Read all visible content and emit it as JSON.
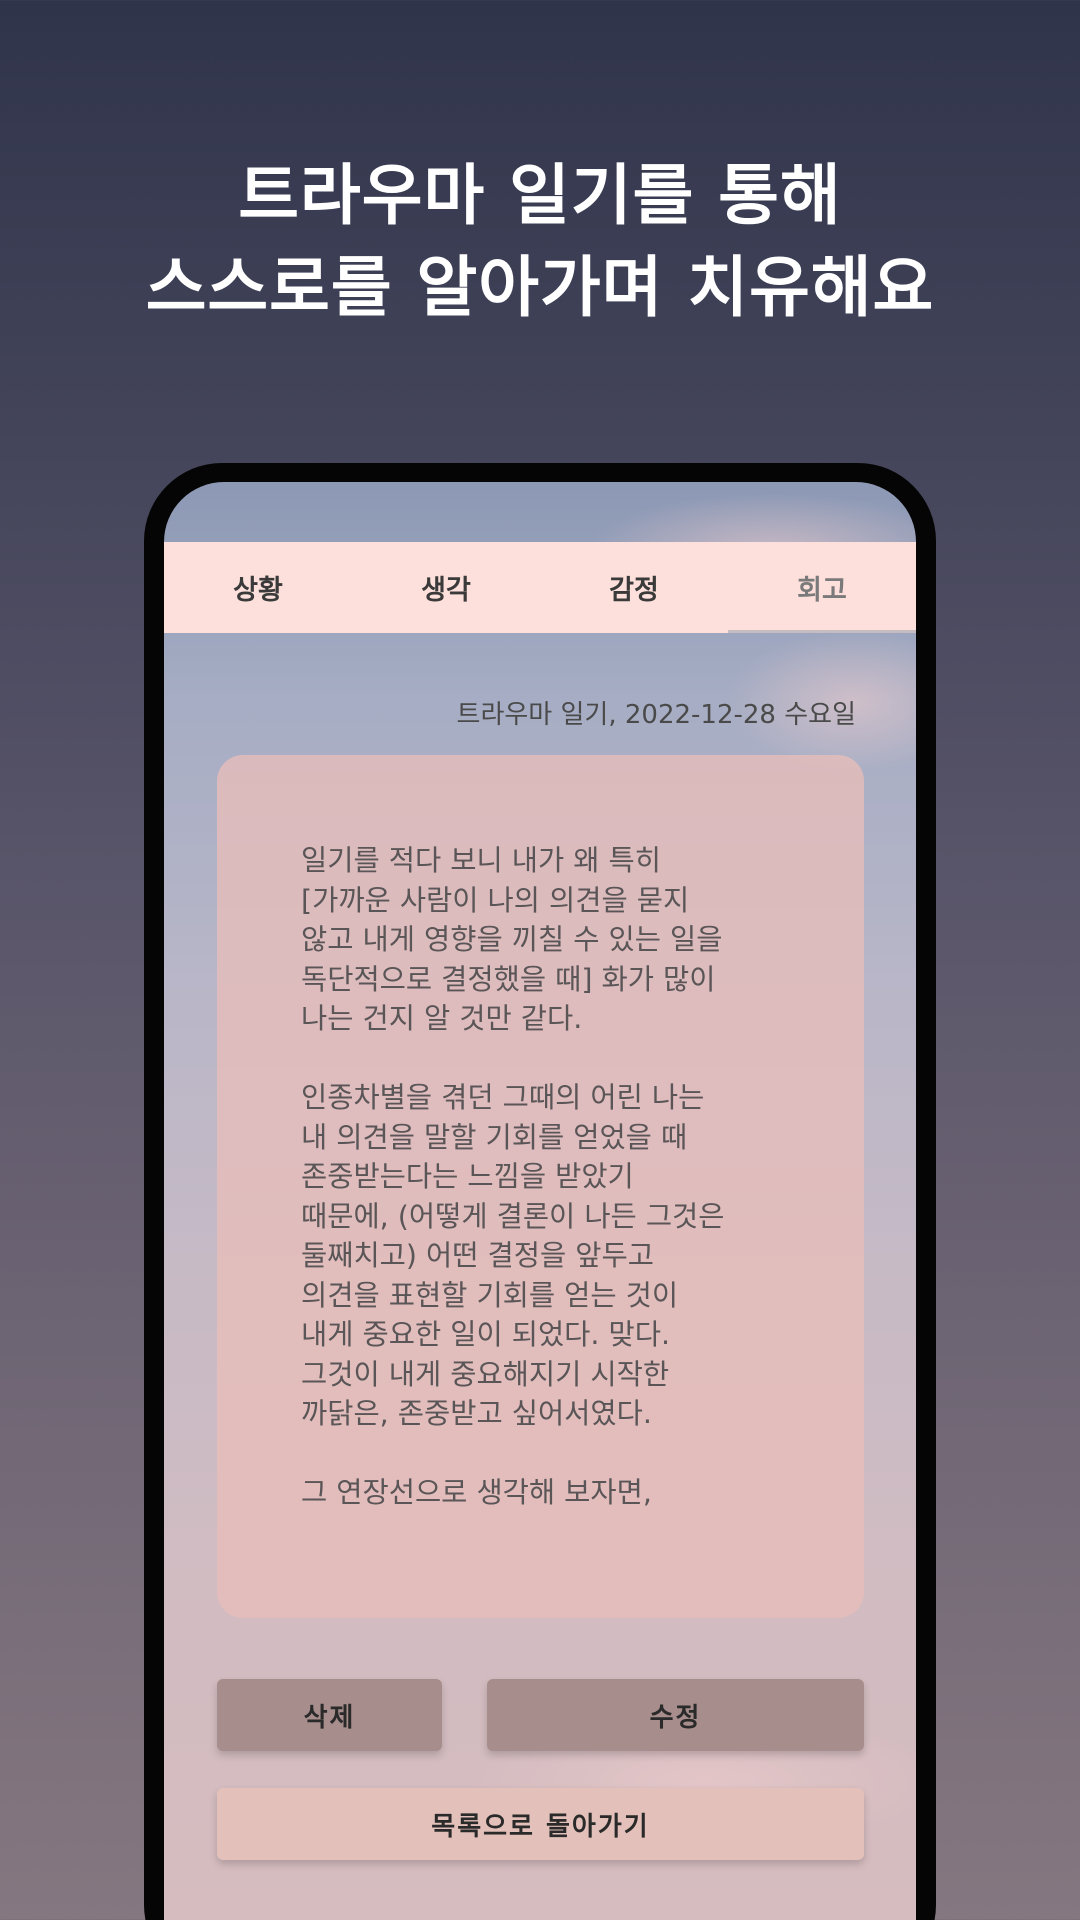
{
  "headline": {
    "line1": "트라우마 일기를 통해",
    "line2": "스스로를 알아가며 치유해요"
  },
  "tabs": [
    {
      "label": "상황",
      "active": false
    },
    {
      "label": "생각",
      "active": false
    },
    {
      "label": "감정",
      "active": false
    },
    {
      "label": "회고",
      "active": true
    }
  ],
  "entry": {
    "date_line": "트라우마 일기,  2022-12-28 수요일",
    "body": "일기를 적다 보니 내가 왜 특히\n[가까운 사람이 나의 의견을 묻지\n않고 내게 영향을 끼칠 수 있는 일을\n독단적으로 결정했을 때] 화가 많이\n나는 건지 알 것만 같다.\n\n인종차별을 겪던 그때의 어린 나는\n내 의견을 말할 기회를 얻었을 때\n존중받는다는 느낌을 받았기\n때문에, (어떻게 결론이 나든 그것은\n둘째치고) 어떤 결정을 앞두고\n의견을 표현할 기회를 얻는 것이\n내게 중요한 일이 되었다. 맞다.\n그것이 내게 중요해지기 시작한\n까닭은, 존중받고 싶어서였다.\n\n그 연장선으로 생각해 보자면,"
  },
  "buttons": {
    "delete": "삭제",
    "edit": "수정",
    "back": "목록으로 돌아가기"
  },
  "colors": {
    "tab_bar": "#fde0db",
    "card": "#e8beba",
    "action_button": "#a78d8c",
    "back_button": "#e3c0b9"
  }
}
